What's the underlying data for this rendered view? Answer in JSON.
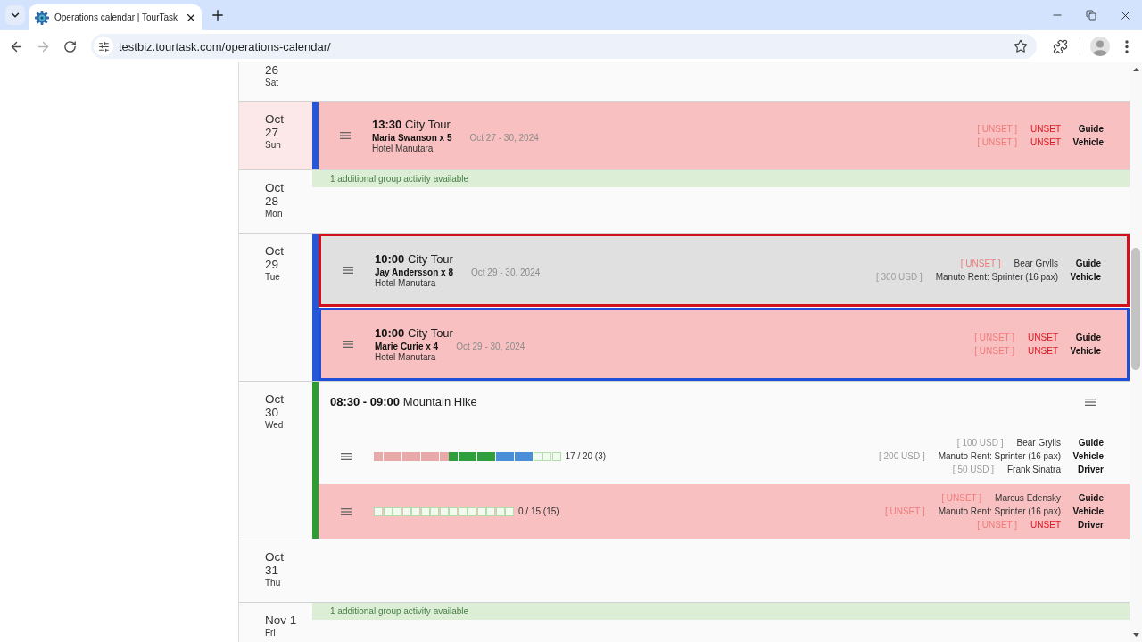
{
  "browser": {
    "tabs": [
      {
        "title": "Operations calendar | TourTask",
        "selected": true
      }
    ],
    "url": "testbiz.tourtask.com/operations-calendar/",
    "forward_disabled": true
  },
  "calendar": {
    "days": [
      {
        "day": "26",
        "weekday": "Sat",
        "highlighted": false
      },
      {
        "month": "Oct",
        "day": "27",
        "weekday": "Sun",
        "highlighted": true,
        "blocks": [
          {
            "kind": "tours",
            "color": "#2557d6",
            "cards": [
              {
                "time": "13:30",
                "name": "City Tour",
                "guest": "Maria Swanson x 5",
                "dates": "Oct 27 - 30, 2024",
                "hotel": "Hotel Manutara",
                "complete": false,
                "flagged": false,
                "selected": false,
                "resources": [
                  {
                    "cost": "[ UNSET ]",
                    "cost_set": false,
                    "assignee": "UNSET",
                    "assignee_set": false,
                    "role": "Guide"
                  },
                  {
                    "cost": "[ UNSET ]",
                    "cost_set": false,
                    "assignee": "UNSET",
                    "assignee_set": false,
                    "role": "Vehicle"
                  }
                ]
              }
            ]
          }
        ]
      },
      {
        "month": "Oct",
        "day": "28",
        "weekday": "Mon",
        "highlighted": false,
        "notice": "1 additional group activity available"
      },
      {
        "month": "Oct",
        "day": "29",
        "weekday": "Tue",
        "highlighted": false,
        "blocks": [
          {
            "kind": "tours",
            "color": "#2557d6",
            "cards": [
              {
                "time": "10:00",
                "name": "City Tour",
                "guest": "Jay Andersson x 8",
                "dates": "Oct 29 - 30, 2024",
                "hotel": "Hotel Manutara",
                "complete": true,
                "flagged": true,
                "selected": false,
                "resources": [
                  {
                    "cost": "[ UNSET ]",
                    "cost_set": false,
                    "assignee": "Bear Grylls",
                    "assignee_set": true,
                    "role": "Guide"
                  },
                  {
                    "cost": "[ 300 USD ]",
                    "cost_set": true,
                    "assignee": "Manuto Rent: Sprinter (16 pax)",
                    "assignee_set": true,
                    "role": "Vehicle"
                  }
                ]
              },
              {
                "time": "10:00",
                "name": "City Tour",
                "guest": "Marie Curie x 4",
                "dates": "Oct 29 - 30, 2024",
                "hotel": "Hotel Manutara",
                "complete": false,
                "flagged": false,
                "selected": true,
                "resources": [
                  {
                    "cost": "[ UNSET ]",
                    "cost_set": false,
                    "assignee": "UNSET",
                    "assignee_set": false,
                    "role": "Guide"
                  },
                  {
                    "cost": "[ UNSET ]",
                    "cost_set": false,
                    "assignee": "UNSET",
                    "assignee_set": false,
                    "role": "Vehicle"
                  }
                ]
              }
            ]
          }
        ]
      },
      {
        "month": "Oct",
        "day": "30",
        "weekday": "Wed",
        "highlighted": false,
        "blocks": [
          {
            "kind": "group",
            "color": "#2e9b35",
            "time": "08:30 - 09:00",
            "name": "Mountain Hike",
            "rows": [
              {
                "complete": true,
                "slots": [
                  {
                    "filled": true,
                    "color": "#e9a9a9"
                  },
                  {
                    "filled": true,
                    "color": "#e9a9a9"
                  },
                  {
                    "filled": true,
                    "color": "#e9a9a9"
                  },
                  {
                    "filled": true,
                    "color": "#e9a9a9"
                  },
                  {
                    "filled": true,
                    "color": "#e9a9a9"
                  },
                  {
                    "filled": true,
                    "color": "#e9a9a9"
                  },
                  {
                    "filled": true,
                    "color": "#e9a9a9"
                  },
                  {
                    "filled": true,
                    "color": "#e9a9a9"
                  },
                  {
                    "filled": true,
                    "color": "#2f9e3c"
                  },
                  {
                    "filled": true,
                    "color": "#2f9e3c"
                  },
                  {
                    "filled": true,
                    "color": "#2f9e3c"
                  },
                  {
                    "filled": true,
                    "color": "#2f9e3c"
                  },
                  {
                    "filled": true,
                    "color": "#2f9e3c"
                  },
                  {
                    "filled": true,
                    "color": "#4a8fd8"
                  },
                  {
                    "filled": true,
                    "color": "#4a8fd8"
                  },
                  {
                    "filled": true,
                    "color": "#4a8fd8"
                  },
                  {
                    "filled": true,
                    "color": "#4a8fd8"
                  },
                  {
                    "filled": false
                  },
                  {
                    "filled": false
                  },
                  {
                    "filled": false
                  }
                ],
                "count": "17 / 20 (3)",
                "resources": [
                  {
                    "cost": "[ 100 USD ]",
                    "cost_set": true,
                    "assignee": "Bear Grylls",
                    "assignee_set": true,
                    "role": "Guide"
                  },
                  {
                    "cost": "[ 200 USD ]",
                    "cost_set": true,
                    "assignee": "Manuto Rent: Sprinter (16 pax)",
                    "assignee_set": true,
                    "role": "Vehicle"
                  },
                  {
                    "cost": "[ 50 USD ]",
                    "cost_set": true,
                    "assignee": "Frank Sinatra",
                    "assignee_set": true,
                    "role": "Driver"
                  }
                ]
              },
              {
                "complete": false,
                "slots": [
                  {
                    "filled": false
                  },
                  {
                    "filled": false
                  },
                  {
                    "filled": false
                  },
                  {
                    "filled": false
                  },
                  {
                    "filled": false
                  },
                  {
                    "filled": false
                  },
                  {
                    "filled": false
                  },
                  {
                    "filled": false
                  },
                  {
                    "filled": false
                  },
                  {
                    "filled": false
                  },
                  {
                    "filled": false
                  },
                  {
                    "filled": false
                  },
                  {
                    "filled": false
                  },
                  {
                    "filled": false
                  },
                  {
                    "filled": false
                  }
                ],
                "count": "0 / 15 (15)",
                "resources": [
                  {
                    "cost": "[ UNSET ]",
                    "cost_set": false,
                    "assignee": "Marcus Edensky",
                    "assignee_set": true,
                    "role": "Guide"
                  },
                  {
                    "cost": "[ UNSET ]",
                    "cost_set": false,
                    "assignee": "Manuto Rent: Sprinter (16 pax)",
                    "assignee_set": true,
                    "role": "Vehicle"
                  },
                  {
                    "cost": "[ UNSET ]",
                    "cost_set": false,
                    "assignee": "UNSET",
                    "assignee_set": false,
                    "role": "Driver"
                  }
                ]
              }
            ]
          }
        ]
      },
      {
        "month": "Oct",
        "day": "31",
        "weekday": "Thu",
        "highlighted": false
      },
      {
        "month": "Nov",
        "day": "1",
        "weekday": "Fri",
        "highlighted": false,
        "notice": "1 additional group activity available"
      }
    ]
  }
}
